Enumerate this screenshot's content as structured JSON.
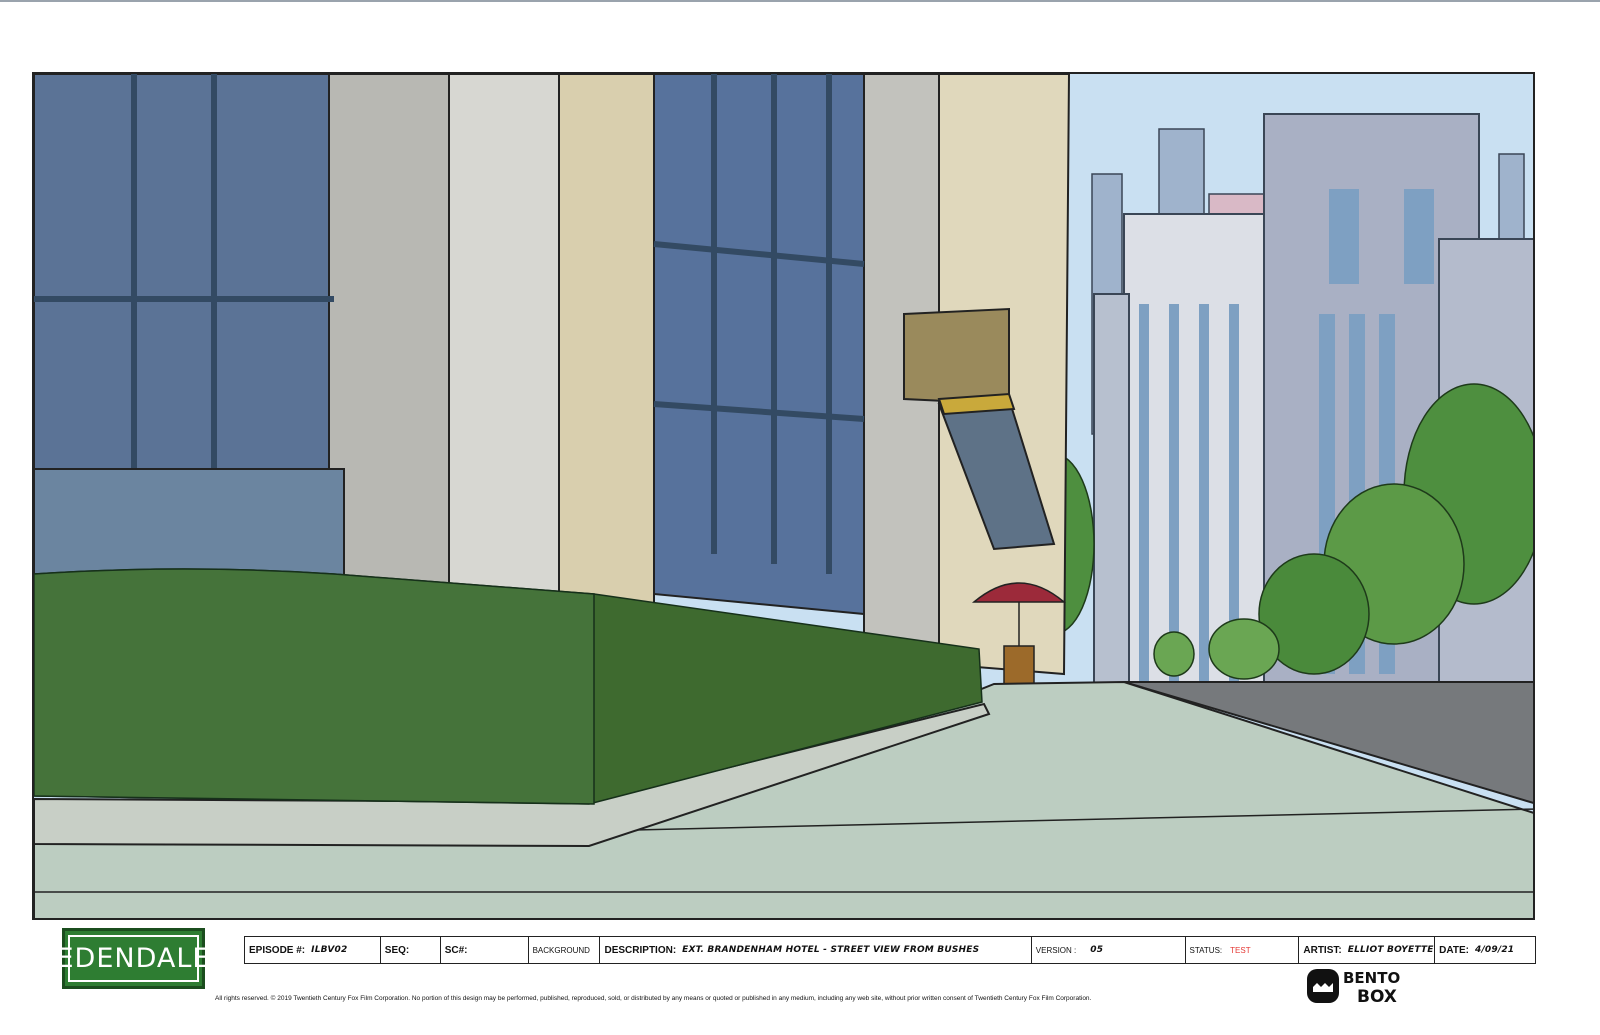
{
  "brand": {
    "logo_text": "EDENDALE"
  },
  "slate": {
    "episode_label": "EPISODE #:",
    "episode_value": "ILBV02",
    "seq_label": "SEQ:",
    "seq_value": "",
    "sc_label": "SC#:",
    "sc_value": "",
    "type_label": "BACKGROUND",
    "description_label": "DESCRIPTION:",
    "description_value": "EXT. BRANDENHAM HOTEL - STREET VIEW FROM BUSHES",
    "version_label": "VERSION :",
    "version_value": "05",
    "status_label": "STATUS:",
    "status_value": "TEST",
    "artist_label": "ARTIST:",
    "artist_value": "ELLIOT BOYETTE",
    "date_label": "DATE:",
    "date_value": "4/09/21"
  },
  "legal": {
    "text": "All rights reserved.  © 2019  Twentieth Century Fox Film Corporation.  No portion of this design may be performed, published, reproduced, sold, or distributed by any means or quoted or published in any medium, including any web site, without prior written consent of Twentieth Century Fox Film Corporation."
  },
  "studio_logo": {
    "text": "BENTO BOX"
  },
  "colors": {
    "sky": "#c9dff0",
    "window_blue": "#4f6a94",
    "stone": "#d9d4be",
    "hedge": "#3f6b2f",
    "sidewalk": "#b9ccc0",
    "logo_green": "#2e7d32",
    "status_red": "#e53935"
  }
}
